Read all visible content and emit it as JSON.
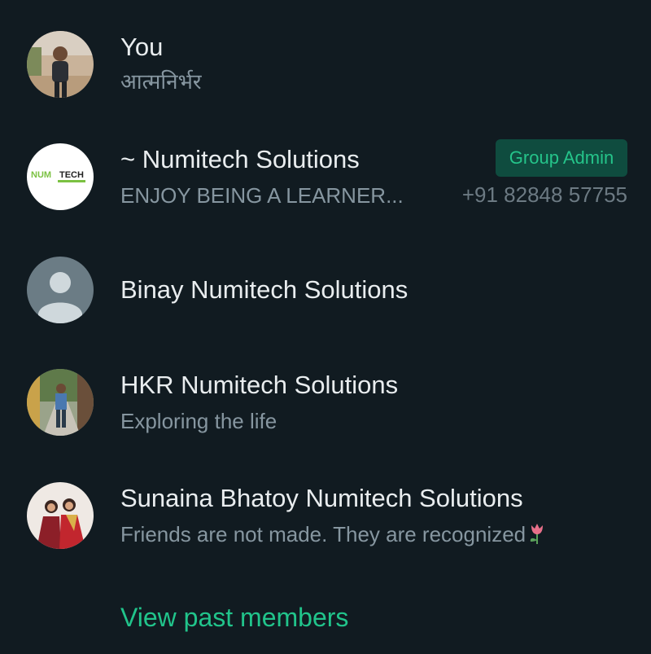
{
  "members": [
    {
      "name": "You",
      "status": "आत्मनिर्भर",
      "avatar": "photo-person-outdoor"
    },
    {
      "name": "~ Numitech Solutions",
      "status": "ENJOY BEING A LEARNER...",
      "phone": "+91 82848 57755",
      "badge": "Group Admin",
      "avatar": "numitech-logo",
      "logo_text_a": "NUM",
      "logo_text_b": "TECH"
    },
    {
      "name": "Binay Numitech Solutions",
      "status": "",
      "avatar": "default-person"
    },
    {
      "name": "HKR Numitech Solutions",
      "status": "Exploring the life",
      "avatar": "photo-person-street"
    },
    {
      "name": "Sunaina Bhatoy Numitech Solutions",
      "status": "Friends are not made. They are recognized",
      "status_emoji": "tulip-icon",
      "avatar": "photo-two-women"
    }
  ],
  "footer": {
    "view_past_members": "View past members"
  },
  "colors": {
    "background": "#111b21",
    "primary_text": "#e9edef",
    "secondary_text": "#8696a0",
    "accent": "#21c48b",
    "badge_bg": "#0f4c3f"
  }
}
